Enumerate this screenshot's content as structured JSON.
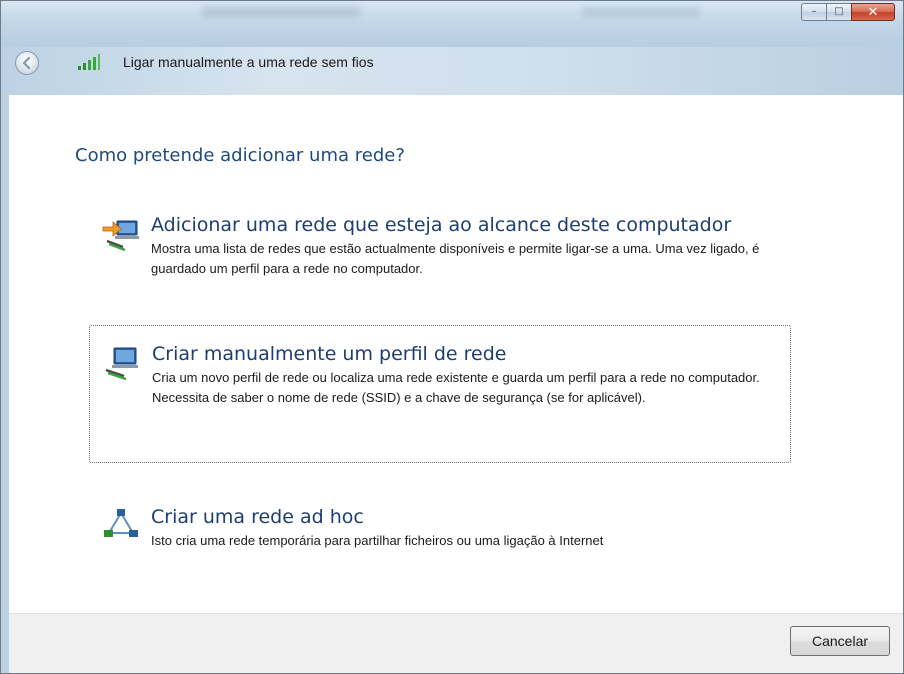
{
  "window": {
    "caption_buttons": {
      "minimize": "–",
      "maximize": "□",
      "close": "✕"
    }
  },
  "nav": {
    "title": "Ligar manualmente a uma rede sem fios"
  },
  "main": {
    "heading": "Como pretende adicionar uma rede?",
    "options": [
      {
        "title": "Adicionar uma rede que esteja ao alcance deste computador",
        "description": "Mostra uma lista de redes que estão actualmente disponíveis e permite ligar-se a uma. Uma vez ligado, é guardado um perfil para a rede no computador.",
        "icon": "network-add-icon"
      },
      {
        "title": "Criar manualmente um perfil de rede",
        "description": "Cria um novo perfil de rede ou localiza uma rede existente e guarda um perfil para a rede no computador. Necessita de saber o nome de rede (SSID) e a chave de segurança (se for aplicável).",
        "icon": "network-profile-icon"
      },
      {
        "title": "Criar uma rede ad hoc",
        "description": "Isto cria uma rede temporária para partilhar ficheiros ou uma ligação à Internet",
        "icon": "adhoc-network-icon"
      }
    ]
  },
  "footer": {
    "cancel_label": "Cancelar"
  },
  "colors": {
    "heading": "#1f4b7c",
    "option_title": "#1d3f70",
    "footer_bg": "#f0f0f0"
  }
}
